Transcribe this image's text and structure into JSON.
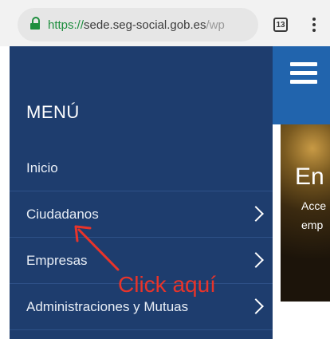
{
  "browser": {
    "url_scheme": "https://",
    "url_host": "sede.seg-social.gob.es",
    "url_path": "/wp",
    "tab_count": "13",
    "icons": [
      "lock-icon",
      "tab-switcher-icon",
      "kebab-menu-icon"
    ]
  },
  "menu": {
    "title": "MENÚ",
    "items": [
      {
        "label": "Inicio",
        "has_submenu": false
      },
      {
        "label": "Ciudadanos",
        "has_submenu": true
      },
      {
        "label": "Empresas",
        "has_submenu": true
      },
      {
        "label": "Administraciones y Mutuas",
        "has_submenu": true
      }
    ]
  },
  "page": {
    "hero_title": "En",
    "hero_line1": "Acce",
    "hero_line2": "emp"
  },
  "annotation": {
    "text": "Click aquí",
    "color": "#e8342a"
  },
  "colors": {
    "menu_bg": "#1e3d6e",
    "header_bg": "#2164ad",
    "secure_green": "#1e8e3e"
  }
}
